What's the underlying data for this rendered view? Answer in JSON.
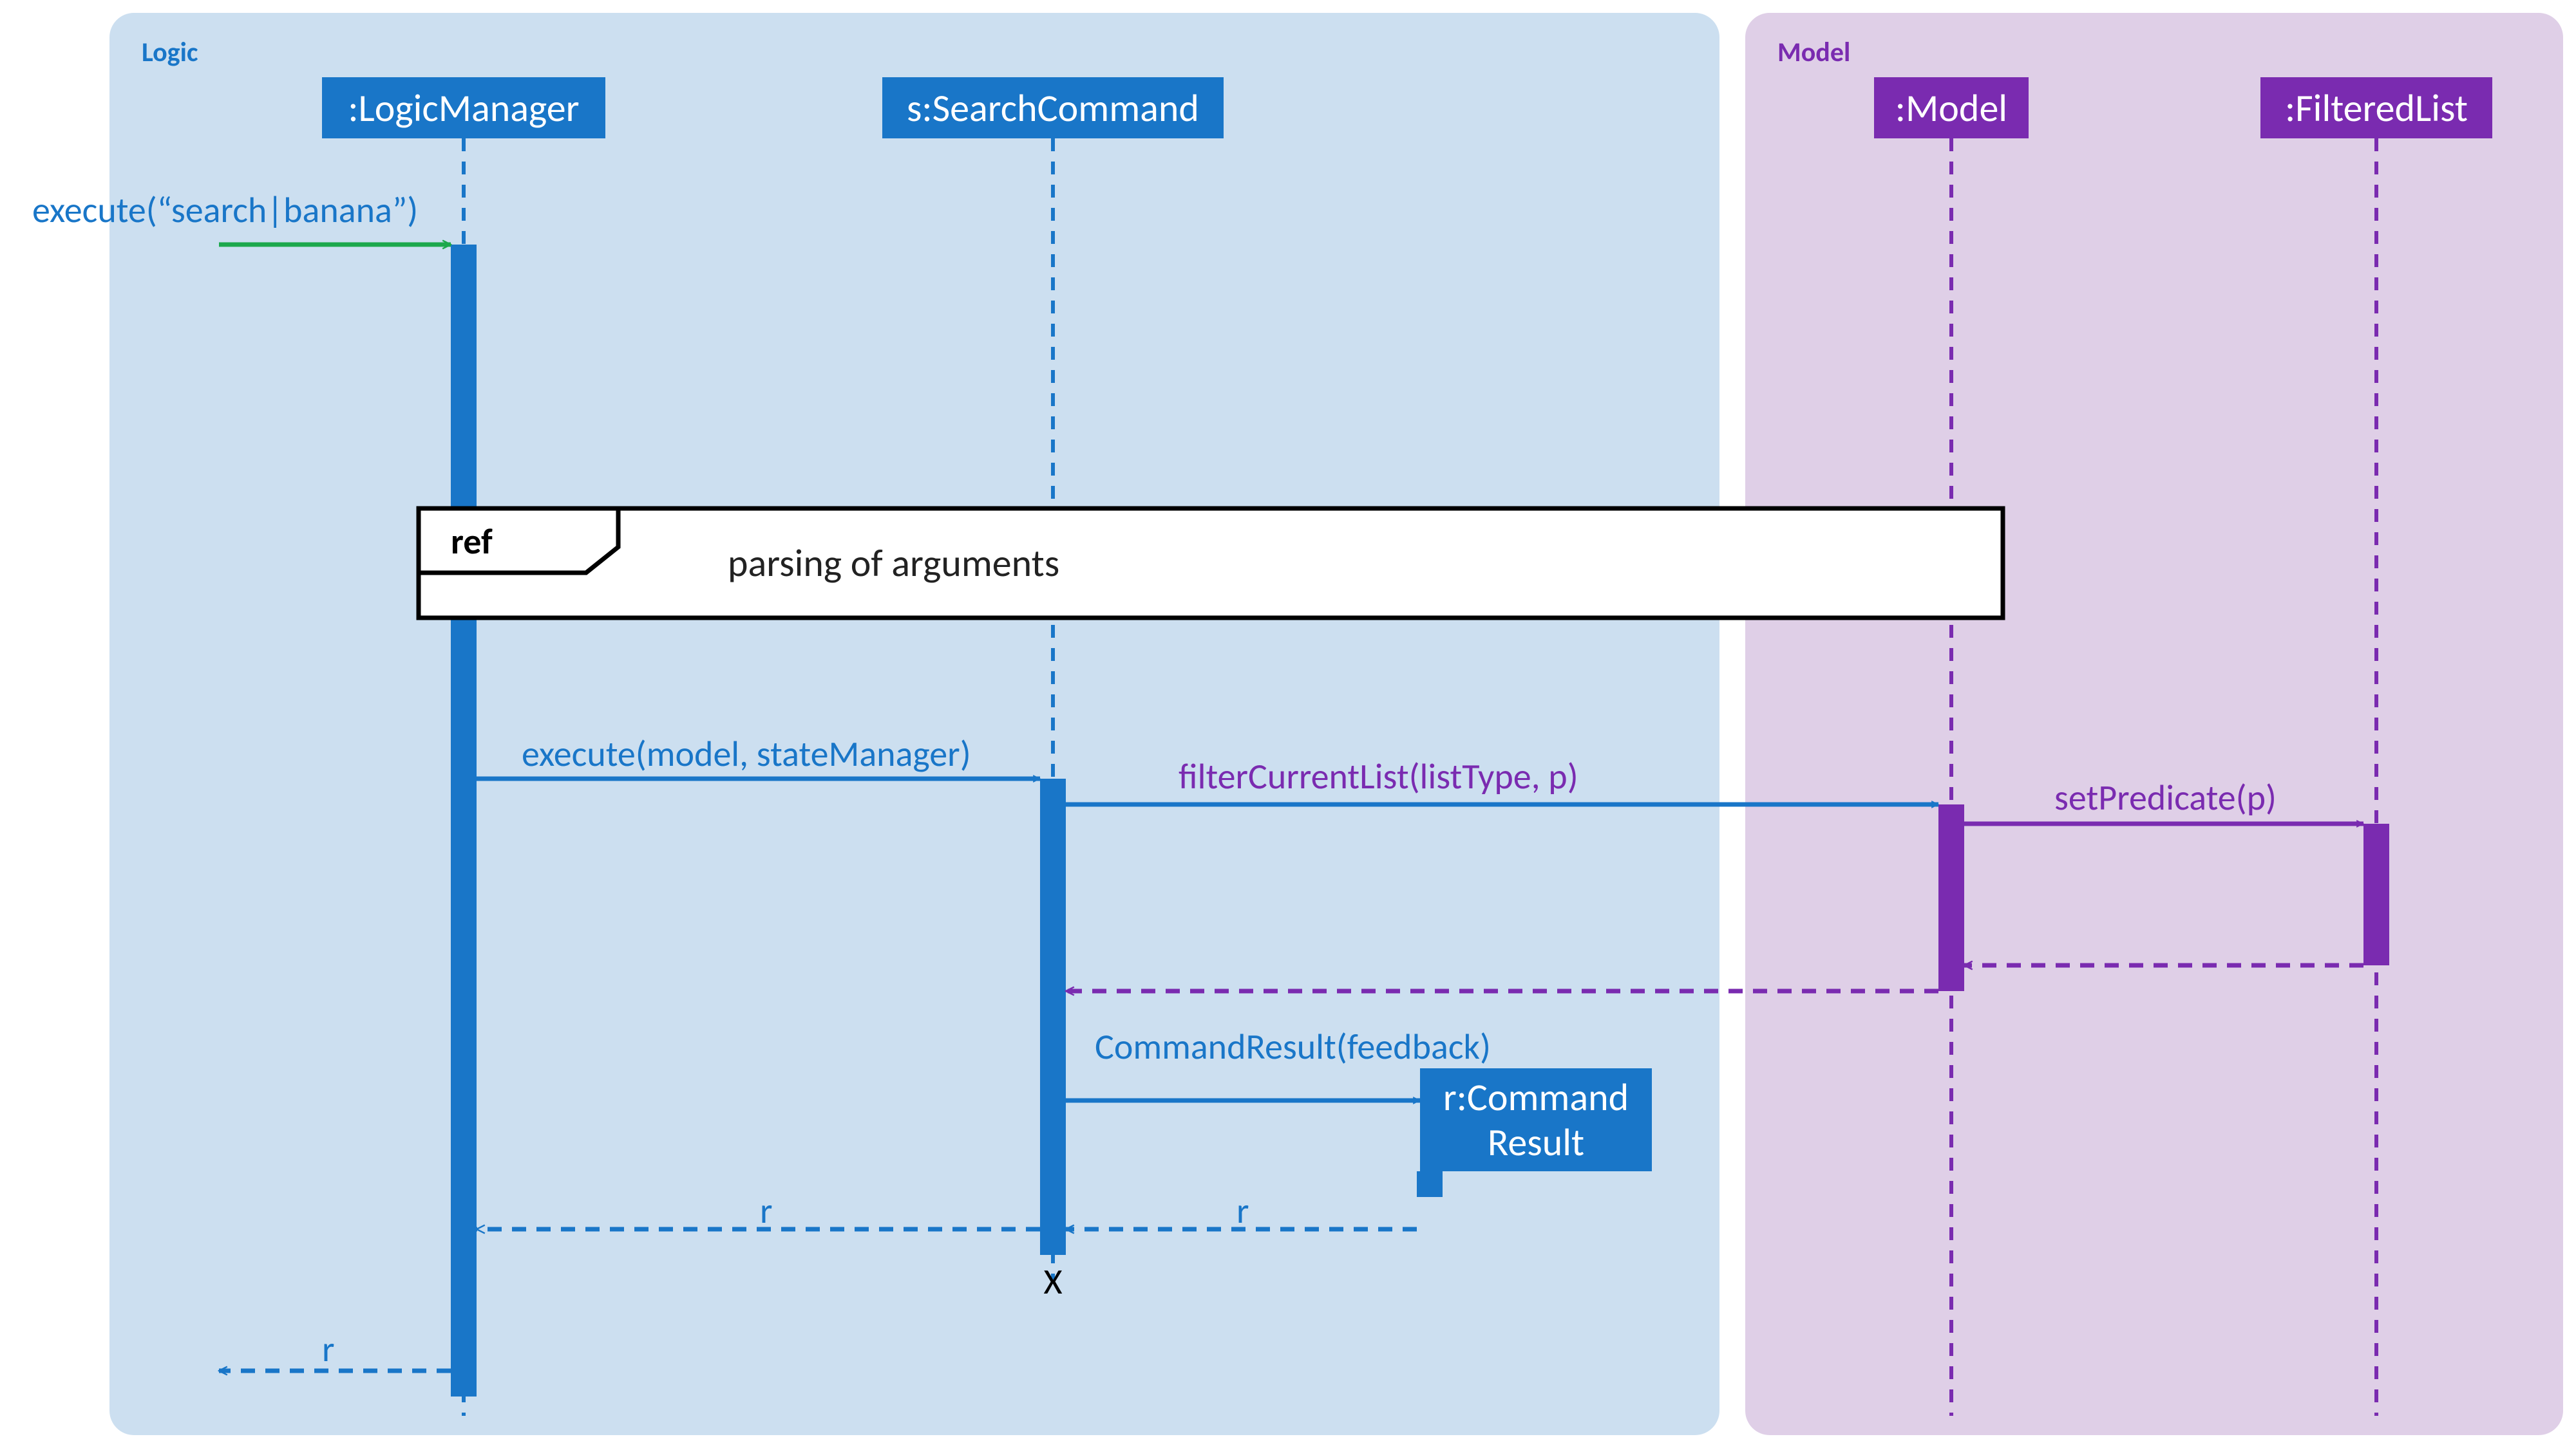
{
  "panels": {
    "logic": "Logic",
    "model": "Model"
  },
  "lifelines": {
    "logicManager": ":LogicManager",
    "searchCommand": "s:SearchCommand",
    "model": ":Model",
    "filteredList": ":FilteredList",
    "commandResult1": "r:Command",
    "commandResult2": "Result"
  },
  "messages": {
    "initialExecute": "execute(“search|banana”)",
    "executeModel": "execute(model, stateManager)",
    "filterCurrent": "filterCurrentList(listType, p)",
    "setPredicate": "setPredicate(p)",
    "commandResultCreate": "CommandResult(feedback)",
    "returnR1": "r",
    "returnR2": "r",
    "returnR3": "r"
  },
  "frame": {
    "label": "ref",
    "text": "parsing of arguments"
  },
  "destroyMark": "X",
  "colors": {
    "blue": "#1976C8",
    "purple": "#7A2BB0",
    "green": "#1CA84C",
    "panelLogic": "#CCDFF0",
    "panelModel": "#DFCFE7"
  }
}
